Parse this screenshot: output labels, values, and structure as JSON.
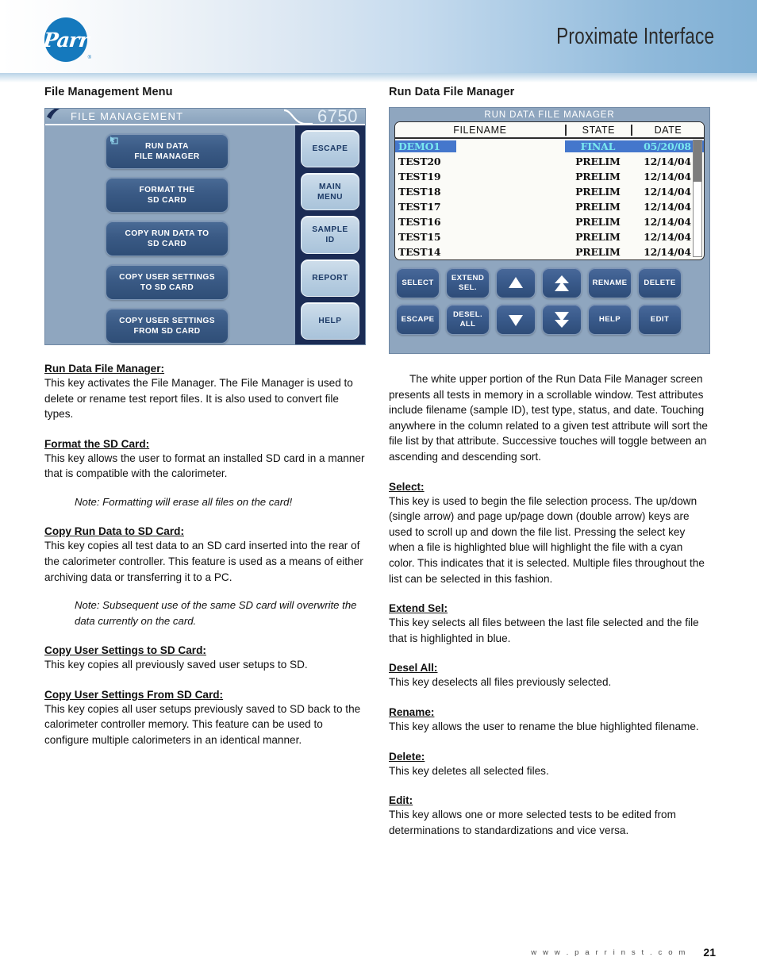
{
  "header": {
    "logo_text": "Parr",
    "logo_registered": "®",
    "title": "Proximate Interface"
  },
  "left_column": {
    "section_title": "File Management Menu",
    "device_screen": {
      "title": "FILE MANAGEMENT",
      "model": "6750",
      "menu_buttons": [
        {
          "line1": "RUN DATA",
          "line2": "FILE MANAGER"
        },
        {
          "line1": "FORMAT THE",
          "line2": "SD CARD"
        },
        {
          "line1": "COPY RUN DATA TO",
          "line2": "SD CARD"
        },
        {
          "line1": "COPY USER SETTINGS",
          "line2": "TO SD CARD"
        },
        {
          "line1": "COPY USER SETTINGS",
          "line2": "FROM SD CARD"
        }
      ],
      "side_buttons": [
        {
          "line1": "ESCAPE",
          "line2": ""
        },
        {
          "line1": "MAIN",
          "line2": "MENU"
        },
        {
          "line1": "SAMPLE",
          "line2": "ID"
        },
        {
          "line1": "REPORT",
          "line2": ""
        },
        {
          "line1": "HELP",
          "line2": ""
        }
      ]
    },
    "entries": [
      {
        "term": "Run Data File Manager:",
        "body": "This key activates the File Manager.  The File Manager is used to delete or rename test report files. It is also used to convert file types.",
        "note": ""
      },
      {
        "term": "Format the SD Card:",
        "body": "This key allows the user to format an installed SD card in a manner that is compatible with the calorimeter.",
        "note": "Note: Formatting will erase all files on the card!"
      },
      {
        "term": "Copy Run Data to SD Card:",
        "body": "This key copies all test data to an SD card inserted into the rear of the calorimeter controller.  This feature is used as a means of either archiving data or transferring it to a PC.",
        "note": "Note: Subsequent use of the same SD card will overwrite the data currently on the card."
      },
      {
        "term": "Copy User Settings to SD Card:",
        "body": "This key copies all previously saved user setups to SD.",
        "note": ""
      },
      {
        "term": "Copy User Settings From SD Card:",
        "body": "This key copies all user setups previously saved to SD back to the calorimeter controller memory.  This feature can be used to configure multiple calorimeters in an identical manner.",
        "note": ""
      }
    ]
  },
  "right_column": {
    "section_title": "Run Data File Manager",
    "device_screen": {
      "title": "RUN DATA FILE MANAGER",
      "columns": [
        "FILENAME",
        "STATE",
        "DATE"
      ],
      "rows": [
        {
          "filename": "DEMO1",
          "state": "FINAL",
          "date": "05/20/08",
          "selected": true
        },
        {
          "filename": "TEST20",
          "state": "PRELIM",
          "date": "12/14/04",
          "selected": false
        },
        {
          "filename": "TEST19",
          "state": "PRELIM",
          "date": "12/14/04",
          "selected": false
        },
        {
          "filename": "TEST18",
          "state": "PRELIM",
          "date": "12/14/04",
          "selected": false
        },
        {
          "filename": "TEST17",
          "state": "PRELIM",
          "date": "12/14/04",
          "selected": false
        },
        {
          "filename": "TEST16",
          "state": "PRELIM",
          "date": "12/14/04",
          "selected": false
        },
        {
          "filename": "TEST15",
          "state": "PRELIM",
          "date": "12/14/04",
          "selected": false
        },
        {
          "filename": "TEST14",
          "state": "PRELIM",
          "date": "12/14/04",
          "selected": false
        }
      ],
      "keys_row1": [
        {
          "line1": "SELECT",
          "line2": "",
          "icon": ""
        },
        {
          "line1": "EXTEND",
          "line2": "SEL.",
          "icon": ""
        },
        {
          "line1": "",
          "line2": "",
          "icon": "arrow-up-icon"
        },
        {
          "line1": "",
          "line2": "",
          "icon": "double-arrow-up-icon"
        },
        {
          "line1": "RENAME",
          "line2": "",
          "icon": ""
        },
        {
          "line1": "DELETE",
          "line2": "",
          "icon": ""
        }
      ],
      "keys_row2": [
        {
          "line1": "ESCAPE",
          "line2": "",
          "icon": ""
        },
        {
          "line1": "DESEL.",
          "line2": "ALL",
          "icon": ""
        },
        {
          "line1": "",
          "line2": "",
          "icon": "arrow-down-icon"
        },
        {
          "line1": "",
          "line2": "",
          "icon": "double-arrow-down-icon"
        },
        {
          "line1": "HELP",
          "line2": "",
          "icon": ""
        },
        {
          "line1": "EDIT",
          "line2": "",
          "icon": ""
        }
      ]
    },
    "intro": "The white upper portion of the Run Data File Manager screen presents all tests in memory in a scrollable window.  Test attributes include filename (sample ID), test type, status, and date.  Touching anywhere in the column related to a given test attribute will sort the file list by that attribute. Successive touches will toggle between an ascending and descending sort.",
    "entries": [
      {
        "term": "Select:",
        "body": "This key is used to begin the file selection process. The up/down (single arrow) and page up/page down (double arrow) keys are used to scroll up and down the file list. Pressing the select key when a file is highlighted blue will highlight the file with a cyan color. This indicates that it is selected. Multiple files throughout the list can be selected in this fashion."
      },
      {
        "term": "Extend Sel:",
        "body": "This key selects all files between the last file selected and the file that is highlighted in blue."
      },
      {
        "term": "Desel All:",
        "body": "This key deselects all files previously selected."
      },
      {
        "term": "Rename:",
        "body": "This key allows the user to rename the blue highlighted filename."
      },
      {
        "term": "Delete:",
        "body": "This key deletes all selected files."
      },
      {
        "term": "Edit:",
        "body": "This key allows one or more selected tests to be edited from determinations to standardizations and vice versa."
      }
    ]
  },
  "footer": {
    "url": "w w w . p a r r i n s t . c o m",
    "page_number": "21"
  },
  "colors": {
    "brand_blue": "#1579bd",
    "screen_bg": "#8fa6bf",
    "key_blue": "#3a5b8c",
    "side_key": "#b9cfe2",
    "selection_blue": "#4477cc",
    "selection_cyan": "#79e8f0",
    "navy_column": "#1b2c55"
  }
}
